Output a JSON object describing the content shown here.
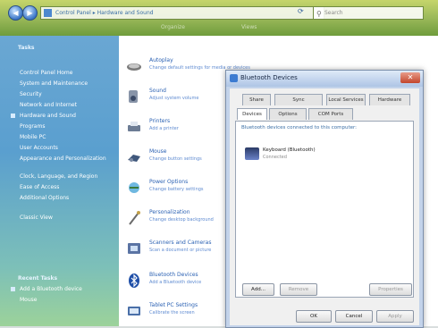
{
  "address": {
    "path": "Control Panel ▸ Hardware and Sound",
    "search_placeholder": "Search"
  },
  "toolbar": {
    "items": [
      "Organize",
      "Views"
    ]
  },
  "sidebar": {
    "header": "Tasks",
    "items": [
      "Control Panel Home",
      "System and Maintenance",
      "Security",
      "Network and Internet",
      "Hardware and Sound",
      "Programs",
      "Mobile PC",
      "User Accounts",
      "Appearance and Personalization",
      "Clock, Language, and Region",
      "Ease of Access",
      "Additional Options",
      "Classic View"
    ],
    "recent_title": "Recent Tasks",
    "recent_items": [
      "Add a Bluetooth device",
      "Mouse"
    ]
  },
  "categories": [
    {
      "title": "Autoplay",
      "sub": "Change default settings for media or devices",
      "icon": "autoplay-icon"
    },
    {
      "title": "Sound",
      "sub": "Adjust system volume",
      "icon": "sound-icon"
    },
    {
      "title": "Printers",
      "sub": "Add a printer",
      "icon": "printer-icon"
    },
    {
      "title": "Mouse",
      "sub": "Change button settings",
      "icon": "mouse-icon"
    },
    {
      "title": "Power Options",
      "sub": "Change battery settings",
      "icon": "power-icon"
    },
    {
      "title": "Personalization",
      "sub": "Change desktop background",
      "icon": "personalization-icon"
    },
    {
      "title": "Scanners and Cameras",
      "sub": "Scan a document or picture",
      "icon": "scanner-icon"
    },
    {
      "title": "Bluetooth Devices",
      "sub": "Add a Bluetooth device",
      "icon": "bluetooth-icon"
    },
    {
      "title": "Tablet PC Settings",
      "sub": "Calibrate the screen",
      "icon": "tablet-icon"
    }
  ],
  "dialog": {
    "title": "Bluetooth Devices",
    "tabs_row1": [
      "Devices",
      "Options",
      "COM Ports",
      "Hardware"
    ],
    "tabs_row2": [
      "Share",
      "Sync",
      "Local Services"
    ],
    "hint": "Bluetooth devices connected to this computer:",
    "device_name": "Keyboard (Bluetooth)",
    "device_sub": "Connected",
    "add_button": "Add...",
    "remove_button": "Remove",
    "properties_button": "Properties",
    "ok_button": "OK",
    "cancel_button": "Cancel",
    "apply_button": "Apply"
  }
}
